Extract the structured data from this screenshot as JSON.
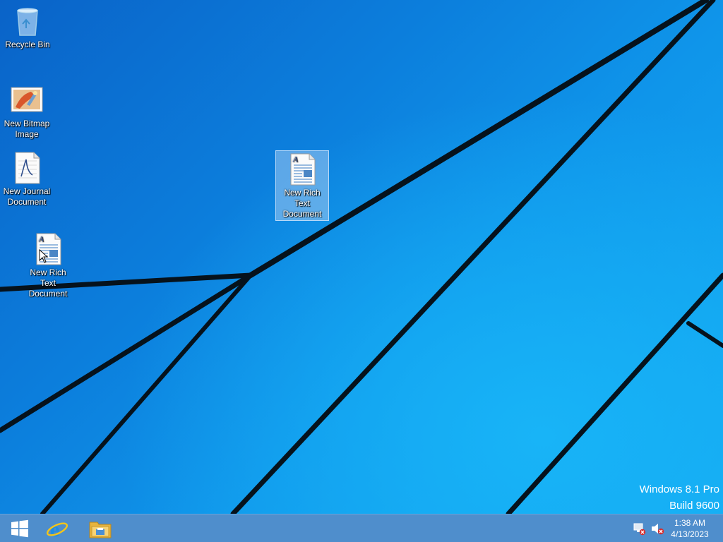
{
  "desktop": {
    "icons": [
      {
        "label": "Recycle Bin",
        "icon": "recycle-bin-icon"
      },
      {
        "label": "New Bitmap Image",
        "icon": "bitmap-image-icon"
      },
      {
        "label": "New Journal Document",
        "icon": "journal-document-icon"
      },
      {
        "label": "New Rich Text Document",
        "icon": "rich-text-document-icon"
      },
      {
        "label": "New Rich Text Document",
        "icon": "rich-text-document-icon",
        "selected": true
      }
    ]
  },
  "watermark": {
    "line1": "Windows 8.1 Pro",
    "line2": "Build 9600"
  },
  "taskbar": {
    "buttons": [
      {
        "name": "start",
        "icon": "windows-logo-icon"
      },
      {
        "name": "internet-explorer",
        "icon": "internet-explorer-icon"
      },
      {
        "name": "file-explorer",
        "icon": "file-explorer-icon"
      }
    ],
    "tray": {
      "network_icon": "network-disconnected-icon",
      "volume_icon": "volume-muted-icon"
    },
    "clock": {
      "time": "1:38 AM",
      "date": "4/13/2023"
    }
  }
}
